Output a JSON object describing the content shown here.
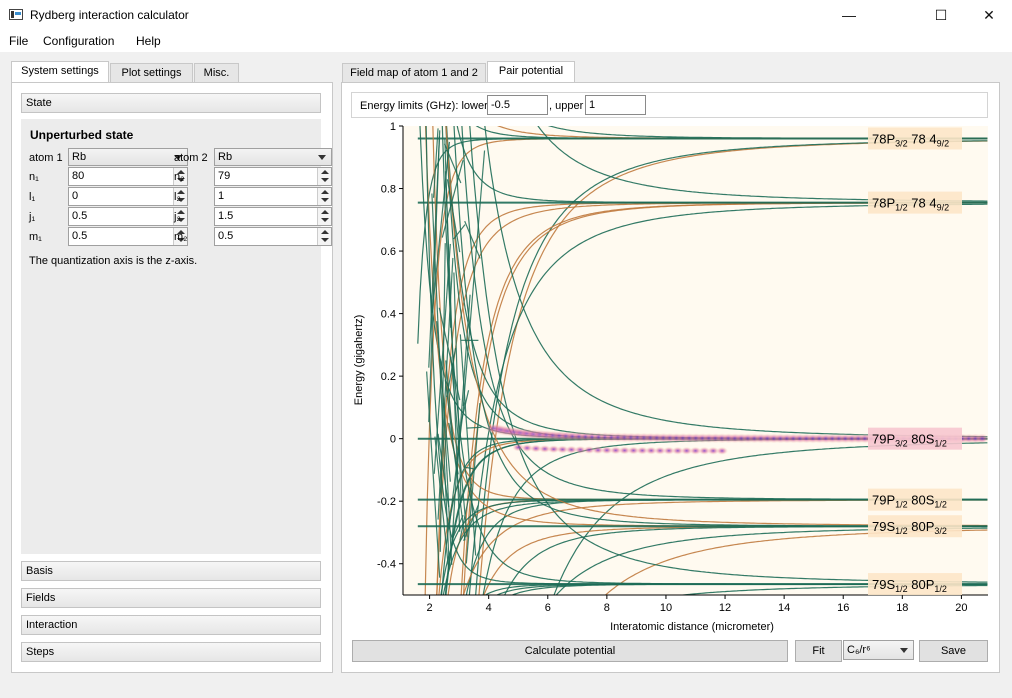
{
  "window": {
    "title": "Rydberg interaction calculator",
    "min_glyph": "—",
    "max_glyph": "☐",
    "close_glyph": "✕"
  },
  "menu": [
    "File",
    "Configuration",
    "Help"
  ],
  "left_tabs": [
    "System settings",
    "Plot settings",
    "Misc."
  ],
  "sections": {
    "state": "State",
    "basis": "Basis",
    "fields": "Fields",
    "interaction": "Interaction",
    "steps": "Steps"
  },
  "state": {
    "heading": "Unperturbed state",
    "atom1_label": "atom 1",
    "atom1_value": "Rb",
    "atom2_label": "atom 2",
    "atom2_value": "Rb",
    "n1_label": "n₁",
    "n1_value": "80",
    "l1_label": "l₁",
    "l1_value": "0",
    "j1_label": "j₁",
    "j1_value": "0.5",
    "m1_label": "m₁",
    "m1_value": "0.5",
    "n2_label": "n₂",
    "n2_value": "79",
    "l2_label": "l₂",
    "l2_value": "1",
    "j2_label": "j₂",
    "j2_value": "1.5",
    "m2_label": "m₂",
    "m2_value": "0.5",
    "note": "The quantization axis is the z-axis."
  },
  "right_tabs": [
    "Field map of atom 1 and 2",
    "Pair potential"
  ],
  "energy_limits": {
    "label": "Energy limits (GHz): lower",
    "lower_value": "-0.5",
    "upper_label": ", upper",
    "upper_value": "1"
  },
  "buttons": {
    "calculate": "Calculate potential",
    "fit": "Fit",
    "fit_model": "C₆/r⁶",
    "save": "Save"
  },
  "chart_data": {
    "type": "line",
    "xlabel": "Interatomic distance (micrometer)",
    "ylabel": "Energy (gigahertz)",
    "xlim": [
      1.1,
      20.9
    ],
    "ylim": [
      -0.5,
      1.0
    ],
    "x_ticks": [
      "2",
      "4",
      "6",
      "8",
      "10",
      "12",
      "14",
      "16",
      "18",
      "20"
    ],
    "y_ticks": [
      "1",
      "0.8",
      "0.6",
      "0.4",
      "0.2",
      "0",
      "-0.2",
      "-0.4"
    ],
    "colors": {
      "curve": "#1d6b56",
      "curve_alt": "#c07a3e",
      "overlap": "#7a33c7",
      "background": "#fffaf0"
    },
    "asymptotes": [
      {
        "energy": 0.96,
        "label_main": "78P",
        "label_sub": "3/2",
        "label_rest": " 78 4",
        "label_sub2": "9/2"
      },
      {
        "energy": 0.755,
        "label_main": "78P",
        "label_sub": "1/2",
        "label_rest": " 78 4",
        "label_sub2": "9/2"
      },
      {
        "energy": 0.0,
        "label_main": "79P",
        "label_sub": "3/2",
        "label_rest": " 80S",
        "label_sub2": "1/2"
      },
      {
        "energy": -0.195,
        "label_main": "79P",
        "label_sub": "1/2",
        "label_rest": " 80S",
        "label_sub2": "1/2"
      },
      {
        "energy": -0.28,
        "label_main": "79S",
        "label_sub": "1/2",
        "label_rest": " 80P",
        "label_sub2": "3/2"
      },
      {
        "energy": -0.465,
        "label_main": "79S",
        "label_sub": "1/2",
        "label_rest": " 80P",
        "label_sub2": "1/2"
      }
    ]
  }
}
